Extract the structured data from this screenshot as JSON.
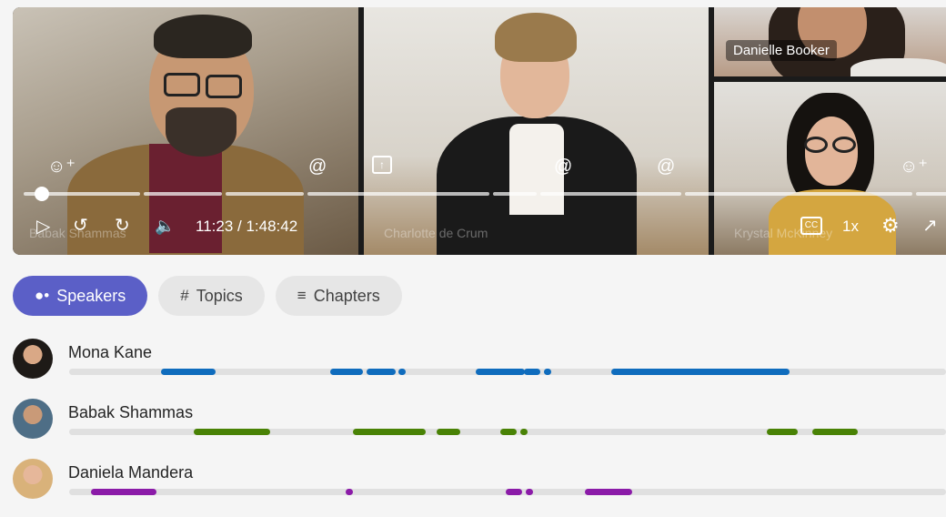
{
  "player": {
    "tiles": [
      {
        "id": "babak",
        "ghost_name": "Babak Shammas"
      },
      {
        "id": "charlotte",
        "ghost_name": "Charlotte de Crum"
      },
      {
        "id": "danielle",
        "name": "Danielle Booker"
      },
      {
        "id": "krystal",
        "ghost_name": "Krystal McKinney"
      }
    ],
    "time": "11:23 / 1:48:42",
    "speed": "1x",
    "progress_fraction": 0.105,
    "controls": [
      "play-icon",
      "rewind-10-icon",
      "forward-10-icon",
      "volume-icon",
      "captions-icon",
      "settings-icon",
      "fullscreen-icon"
    ]
  },
  "tabs": [
    {
      "label": "Speakers",
      "icon": "people-icon",
      "active": true
    },
    {
      "label": "Topics",
      "icon": "hash-icon",
      "active": false
    },
    {
      "label": "Chapters",
      "icon": "list-icon",
      "active": false
    }
  ],
  "speakers": [
    {
      "name": "Mona Kane",
      "color": "#0f6cbd"
    },
    {
      "name": "Babak Shammas",
      "color": "#498205"
    },
    {
      "name": "Daniela Mandera",
      "color": "#8b1ba8"
    }
  ],
  "colors": {
    "accent": "#5b5fc7"
  }
}
